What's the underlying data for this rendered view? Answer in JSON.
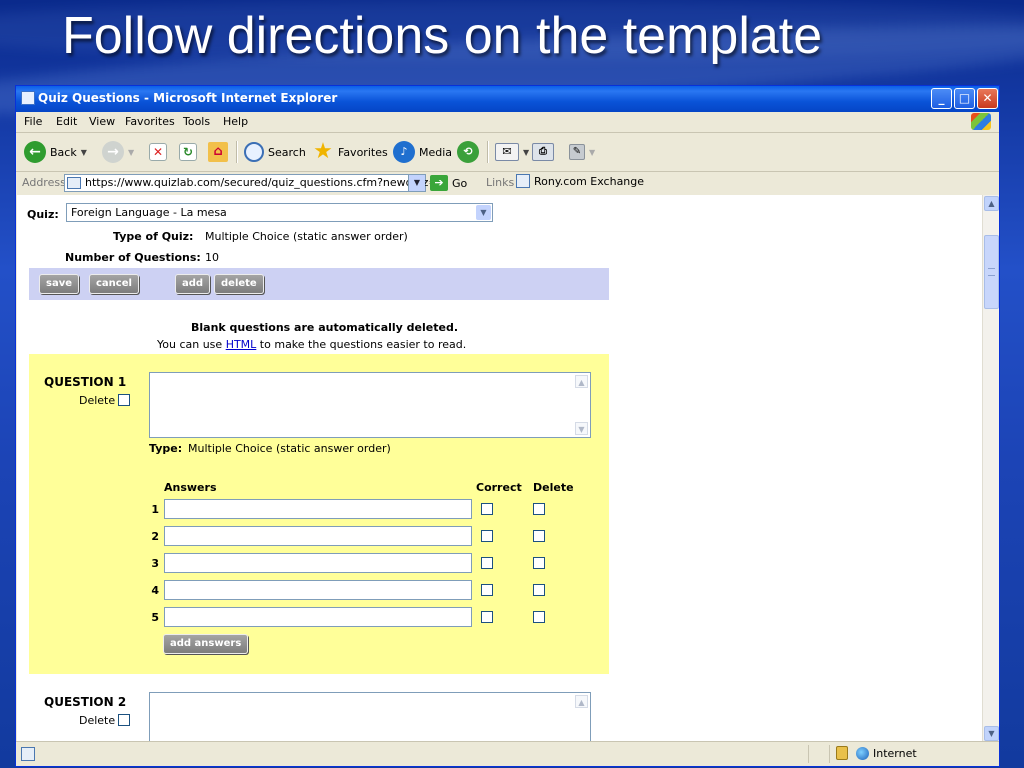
{
  "slide": {
    "title": "Follow directions on the template"
  },
  "browser": {
    "window_title": "Quiz Questions - Microsoft Internet Explorer",
    "window_buttons": {
      "minimize": "_",
      "maximize": "□",
      "close": "✕"
    },
    "menu": [
      "File",
      "Edit",
      "View",
      "Favorites",
      "Tools",
      "Help"
    ],
    "toolbar": {
      "back": "Back",
      "search": "Search",
      "favorites": "Favorites",
      "media": "Media"
    },
    "address": {
      "label": "Address",
      "url": "https://www.quizlab.com/secured/quiz_questions.cfm?newquiz=Y",
      "go": "Go",
      "links_label": "Links",
      "link_item": "Rony.com Exchange"
    },
    "status": {
      "zone": "Internet"
    }
  },
  "quiz": {
    "quiz_label": "Quiz:",
    "selected_quiz": "Foreign Language - La mesa",
    "type_label": "Type of Quiz:",
    "type_value": "Multiple Choice (static answer order)",
    "count_label": "Number of Questions:",
    "count_value": "10",
    "buttons": {
      "save": "save",
      "cancel": "cancel",
      "add": "add",
      "delete": "delete"
    },
    "notice_bold": "Blank questions are automatically deleted.",
    "notice_prefix": "You can use ",
    "notice_link": "HTML",
    "notice_suffix": " to make the questions easier to read."
  },
  "questions": [
    {
      "heading": "QUESTION 1",
      "delete_label": "Delete",
      "type_label": "Type:",
      "type_value": "Multiple Choice (static answer order)",
      "answers_header": "Answers",
      "correct_header": "Correct",
      "delete_header": "Delete",
      "answer_numbers": [
        "1",
        "2",
        "3",
        "4",
        "5"
      ],
      "add_answers": "add answers"
    },
    {
      "heading": "QUESTION 2",
      "delete_label": "Delete"
    }
  ],
  "icons": {
    "back": "back-arrow-icon",
    "forward": "forward-arrow-icon",
    "stop": "stop-icon",
    "refresh": "refresh-icon",
    "home": "home-icon",
    "search": "search-icon",
    "favorites": "star-icon",
    "media": "media-icon",
    "history": "history-icon",
    "mail": "mail-icon",
    "print": "print-icon",
    "edit": "edit-icon",
    "go": "go-arrow-icon",
    "lock": "lock-icon",
    "zone": "globe-icon"
  },
  "colors": {
    "titlebar": "#0a53d8",
    "action_band": "#cdd1f3",
    "question_panel": "#ffff99",
    "link": "#0000cc"
  }
}
